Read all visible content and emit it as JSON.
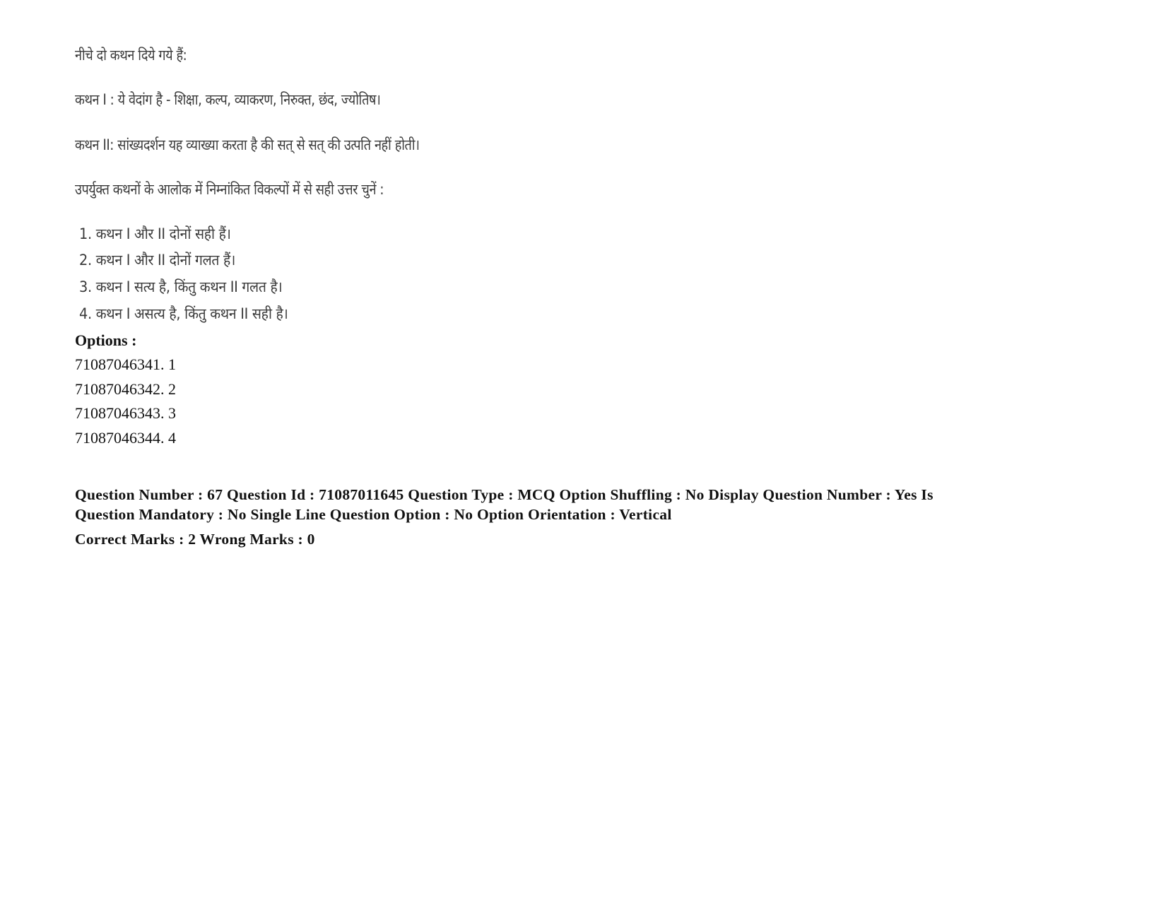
{
  "question": {
    "intro": "नीचे दो कथन दिये गये हैं:",
    "statement_1": "कथन I : ये वेदांग है - शिक्षा, कल्प, व्याकरण, निरुक्त, छंद, ज्योतिष।",
    "statement_2": "कथन II: सांख्यदर्शन यह व्याख्या करता है की सत् से सत् की उत्पति नहीं होती।",
    "instruction": "उपर्युक्त कथनों के आलोक में निम्नांकित विकल्पों में से  सही उत्तर चुनें :",
    "choices": [
      "1. कथन I और II दोनों सही हैं।",
      "2. कथन I और II दोनों गलत  हैं।",
      "3. कथन I सत्य है, किंतु कथन II गलत  है।",
      "4. कथन I असत्य है, किंतु कथन II सही  है।"
    ]
  },
  "options": {
    "label": "Options :",
    "items": [
      "71087046341. 1",
      "71087046342. 2",
      "71087046343. 3",
      "71087046344. 4"
    ]
  },
  "metadata": {
    "line_1": "Question Number : 67 Question Id : 71087011645 Question Type : MCQ Option Shuffling : No Display Question Number : Yes Is",
    "line_2": "Question Mandatory : No Single Line Question Option : No Option Orientation : Vertical",
    "marks": "Correct Marks : 2 Wrong Marks : 0"
  }
}
